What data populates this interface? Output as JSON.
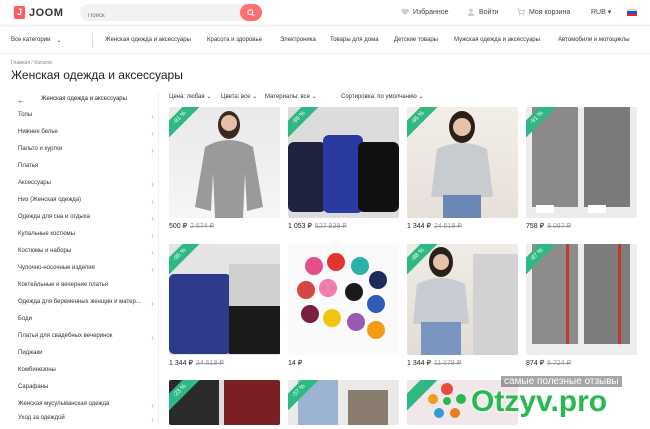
{
  "header": {
    "logo_mark": "J",
    "logo_text": "JOOM",
    "search_placeholder": "Поиск",
    "favorites": "Избранное",
    "login": "Войти",
    "cart": "Моя корзина",
    "currency": "RUB ▾"
  },
  "nav": {
    "all_categories": "Все категории",
    "links": [
      "Женская одежда и аксессуары",
      "Красота и здоровье",
      "Электроника",
      "Товары для дома",
      "Детские товары",
      "Мужская одежда и аксессуары",
      "Автомобили и мотоциклы"
    ]
  },
  "breadcrumbs": "Главная  /  Каталог",
  "page_title": "Женская одежда и аксессуары",
  "sidebar": {
    "heading": "Женская одежда и аксессуары",
    "items": [
      {
        "label": "Топы",
        "chevron": "›"
      },
      {
        "label": "Нижнее белье",
        "chevron": "›"
      },
      {
        "label": "Пальто и куртки",
        "chevron": "›"
      },
      {
        "label": "Платья",
        "chevron": ""
      },
      {
        "label": "Аксессуары",
        "chevron": "›"
      },
      {
        "label": "Низ (Женская одежда)",
        "chevron": "›"
      },
      {
        "label": "Одежда для сна и отдыха",
        "chevron": "›"
      },
      {
        "label": "Купальные костюмы",
        "chevron": "›"
      },
      {
        "label": "Костюмы и наборы",
        "chevron": "›"
      },
      {
        "label": "Чулочно-носочные изделия",
        "chevron": "›"
      },
      {
        "label": "Коктейльные и вечерние платья",
        "chevron": ""
      },
      {
        "label": "Одежда для беременных женщин и матер...",
        "chevron": "›"
      },
      {
        "label": "Боди",
        "chevron": ""
      },
      {
        "label": "Платья для свадебных вечеринок",
        "chevron": "›"
      },
      {
        "label": "Пиджаки",
        "chevron": ""
      },
      {
        "label": "Комбинезоны",
        "chevron": ""
      },
      {
        "label": "Сарафаны",
        "chevron": ""
      },
      {
        "label": "Женская мусульманская одежда",
        "chevron": "›"
      },
      {
        "label": "Уход за одеждой",
        "chevron": "›"
      }
    ]
  },
  "filters": {
    "price": "Цена: любая ⌄",
    "color": "Цвета: все ⌄",
    "material": "Материалы: все ⌄",
    "sort": "Сортировка: по умолчанию ⌄"
  },
  "products": [
    {
      "discount": "-81 %",
      "price": "500 ₽",
      "old_price": "2 674 ₽"
    },
    {
      "discount": "-99 %",
      "price": "1 053 ₽",
      "old_price": "527 938 ₽"
    },
    {
      "discount": "-95 %",
      "price": "1 344 ₽",
      "old_price": "24 618 ₽"
    },
    {
      "discount": "-91 %",
      "price": "758 ₽",
      "old_price": "8 087 ₽"
    },
    {
      "discount": "-95 %",
      "price": "1 344 ₽",
      "old_price": "24 618 ₽"
    },
    {
      "discount": "",
      "price": "14 ₽",
      "old_price": ""
    },
    {
      "discount": "-88 %",
      "price": "1 344 ₽",
      "old_price": "11 178 ₽"
    },
    {
      "discount": "-87 %",
      "price": "874 ₽",
      "old_price": "6 724 ₽"
    },
    {
      "discount": "-23 %",
      "price": "",
      "old_price": ""
    },
    {
      "discount": "-57 %",
      "price": "",
      "old_price": ""
    },
    {
      "discount": "",
      "price": "",
      "old_price": ""
    }
  ],
  "watermark": {
    "tagline": "самые полезные отзывы",
    "brand": "Otzyv.pro"
  },
  "colors": {
    "accent": "#ff6f6f",
    "badge": "#2fb882",
    "watermark": "#28b850"
  }
}
